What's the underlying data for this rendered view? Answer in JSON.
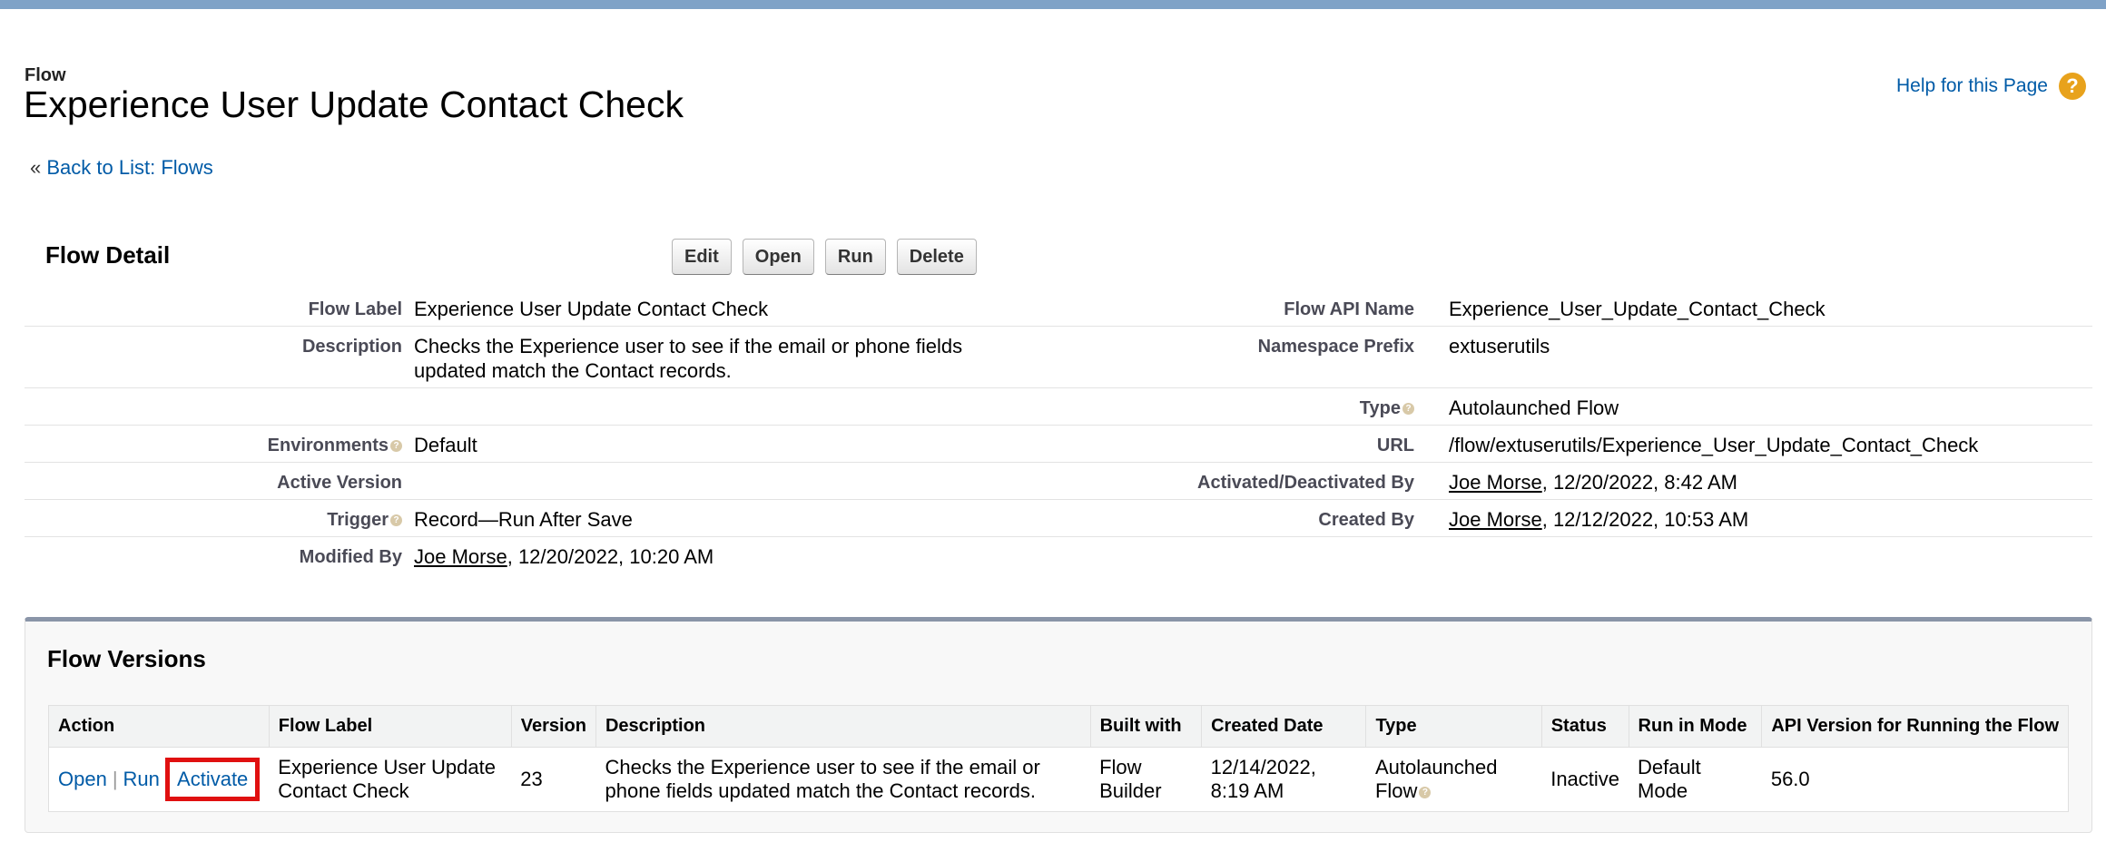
{
  "header": {
    "page_type": "Flow",
    "title": "Experience User Update Contact Check",
    "help_link": "Help for this Page",
    "help_icon": "question-icon",
    "back_prefix": "«",
    "back_link": "Back to List: Flows"
  },
  "detail": {
    "title": "Flow Detail",
    "buttons": {
      "edit": "Edit",
      "open": "Open",
      "run": "Run",
      "delete": "Delete"
    },
    "flow_label": {
      "label": "Flow Label",
      "value": "Experience User Update Contact Check"
    },
    "description": {
      "label": "Description",
      "value": "Checks the Experience user to see if the email or phone fields updated match the Contact records."
    },
    "environments": {
      "label": "Environments",
      "value": "Default"
    },
    "active_version": {
      "label": "Active Version",
      "value": ""
    },
    "trigger": {
      "label": "Trigger",
      "value": "Record—Run After Save"
    },
    "modified_by": {
      "label": "Modified By",
      "user": "Joe Morse",
      "date": ", 12/20/2022, 10:20 AM"
    },
    "api_name": {
      "label": "Flow API Name",
      "value": "Experience_User_Update_Contact_Check"
    },
    "namespace": {
      "label": "Namespace Prefix",
      "value": "extuserutils"
    },
    "type": {
      "label": "Type",
      "value": "Autolaunched Flow"
    },
    "url": {
      "label": "URL",
      "value": "/flow/extuserutils/Experience_User_Update_Contact_Check"
    },
    "activated_by": {
      "label": "Activated/Deactivated By",
      "user": "Joe Morse",
      "date": ", 12/20/2022, 8:42 AM"
    },
    "created_by": {
      "label": "Created By",
      "user": "Joe Morse",
      "date": ", 12/12/2022, 10:53 AM"
    }
  },
  "versions": {
    "title": "Flow Versions",
    "columns": [
      "Action",
      "Flow Label",
      "Version",
      "Description",
      "Built with",
      "Created Date",
      "Type",
      "Status",
      "Run in Mode",
      "API Version for Running the Flow"
    ],
    "row": {
      "action_open": "Open",
      "action_sep": "|",
      "action_run": "Run",
      "action_activate": "Activate",
      "flow_label": "Experience User Update Contact Check",
      "version": "23",
      "description": "Checks the Experience user to see if the email or phone fields updated match the Contact records.",
      "built_with": "Flow Builder",
      "created_date": "12/14/2022, 8:19 AM",
      "type": "Autolaunched Flow",
      "status": "Inactive",
      "run_mode": "Default Mode",
      "api_version": "56.0"
    }
  },
  "colors": {
    "link": "#015ba7",
    "highlight": "#e01010",
    "help_icon": "#e8a21c"
  }
}
